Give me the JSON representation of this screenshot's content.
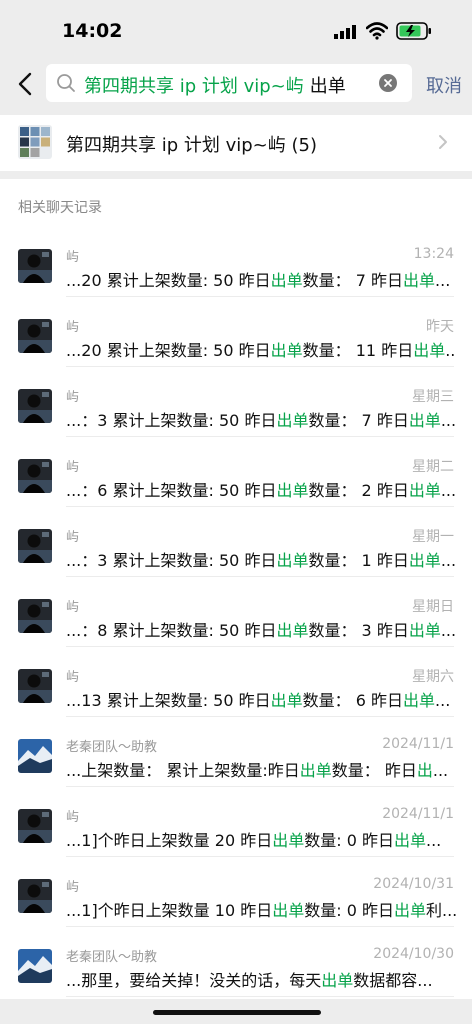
{
  "status_bar": {
    "time": "14:02"
  },
  "search": {
    "query_highlight": "第四期共享 ip 计划 vip~屿",
    "query_plain": "出单",
    "cancel_label": "取消"
  },
  "group_result": {
    "name": "第四期共享 ip 计划 vip~屿 (5)"
  },
  "section_title": "相关聊天记录",
  "colors": {
    "highlight": "#07a34a",
    "link": "#576b95"
  },
  "chats": [
    {
      "sender": "屿",
      "time": "13:24",
      "avatar": "person-dark",
      "pre": "...20 累计上架数量: 50 昨日",
      "kw": "出单",
      "mid": "数量：  7 昨日",
      "kw2": "出单",
      "post": "..."
    },
    {
      "sender": "屿",
      "time": "昨天",
      "avatar": "person-dark",
      "pre": "...20 累计上架数量: 50 昨日",
      "kw": "出单",
      "mid": "数量：  11 昨日",
      "kw2": "出单",
      "post": "..."
    },
    {
      "sender": "屿",
      "time": "星期三",
      "avatar": "person-dark",
      "pre": "...：3 累计上架数量: 50 昨日",
      "kw": "出单",
      "mid": "数量：  7 昨日",
      "kw2": "出单",
      "post": "..."
    },
    {
      "sender": "屿",
      "time": "星期二",
      "avatar": "person-dark",
      "pre": "...：6 累计上架数量: 50 昨日",
      "kw": "出单",
      "mid": "数量：  2 昨日",
      "kw2": "出单",
      "post": "..."
    },
    {
      "sender": "屿",
      "time": "星期一",
      "avatar": "person-dark",
      "pre": "...：3 累计上架数量: 50 昨日",
      "kw": "出单",
      "mid": "数量：  1 昨日",
      "kw2": "出单",
      "post": "..."
    },
    {
      "sender": "屿",
      "time": "星期日",
      "avatar": "person-dark",
      "pre": "...：8 累计上架数量: 50 昨日",
      "kw": "出单",
      "mid": "数量：  3 昨日",
      "kw2": "出单",
      "post": "..."
    },
    {
      "sender": "屿",
      "time": "星期六",
      "avatar": "person-dark",
      "pre": "...13 累计上架数量: 50 昨日",
      "kw": "出单",
      "mid": "数量：  6 昨日",
      "kw2": "出单",
      "post": "..."
    },
    {
      "sender": "老秦团队～助教",
      "time": "2024/11/1",
      "avatar": "landscape-blue",
      "pre": "...上架数量：  累计上架数量:昨日",
      "kw": "出单",
      "mid": "数量：  昨日",
      "kw2": "出",
      "post": "..."
    },
    {
      "sender": "屿",
      "time": "2024/11/1",
      "avatar": "person-dark",
      "pre": "...1]个昨日上架数量 20 昨日",
      "kw": "出单",
      "mid": "数量: 0 昨日",
      "kw2": "出单",
      "post": "..."
    },
    {
      "sender": "屿",
      "time": "2024/10/31",
      "avatar": "person-dark",
      "pre": "...1]个昨日上架数量 10 昨日",
      "kw": "出单",
      "mid": "数量: 0 昨日",
      "kw2": "出单",
      "post": "利..."
    },
    {
      "sender": "老秦团队～助教",
      "time": "2024/10/30",
      "avatar": "landscape-blue",
      "pre": "...那里，要给关掉！没关的话，每天",
      "kw": "出单",
      "mid": "数据都容...",
      "kw2": "",
      "post": ""
    }
  ]
}
